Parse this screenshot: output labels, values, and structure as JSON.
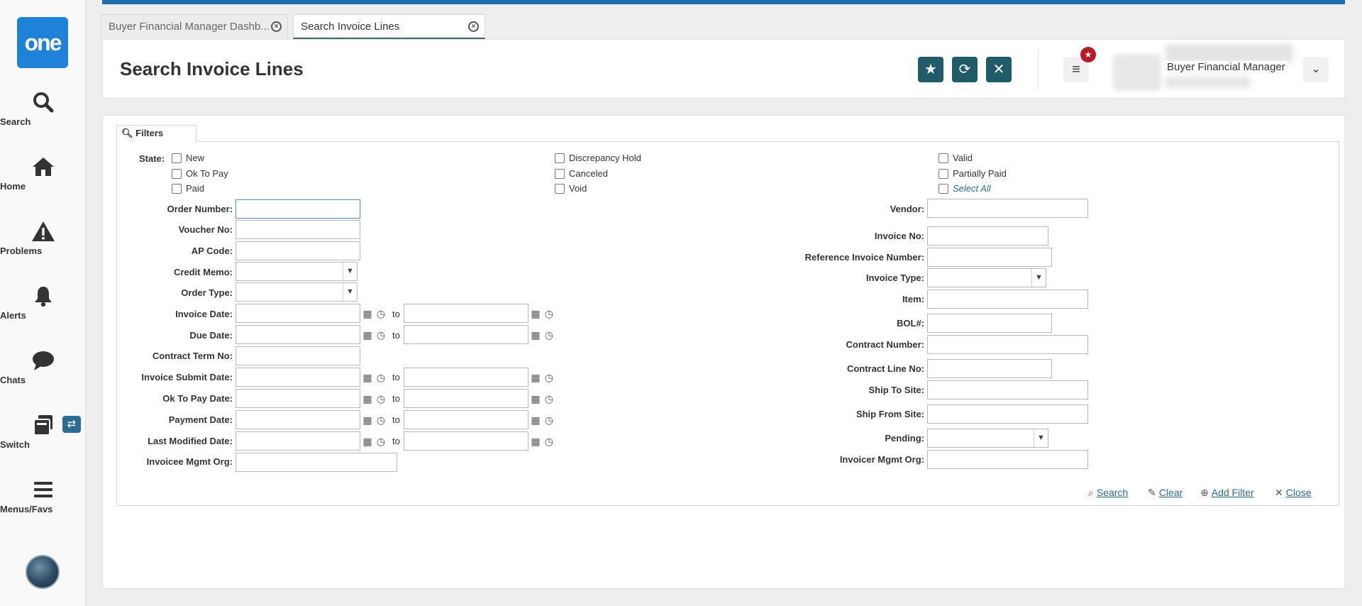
{
  "rail": {
    "logo": "one",
    "items": [
      {
        "label": "Search"
      },
      {
        "label": "Home"
      },
      {
        "label": "Problems"
      },
      {
        "label": "Alerts"
      },
      {
        "label": "Chats"
      },
      {
        "label": "Switch"
      },
      {
        "label": "Menus/Favs"
      }
    ]
  },
  "tabs": [
    {
      "label": "Buyer Financial Manager Dashb..."
    },
    {
      "label": "Search Invoice Lines"
    }
  ],
  "header": {
    "title": "Search Invoice Lines",
    "role": "Buyer Financial Manager"
  },
  "filters": {
    "tab_label": "Filters",
    "state_label": "State:",
    "states": [
      {
        "label": "New",
        "checked": false
      },
      {
        "label": "Ok To Pay",
        "checked": false
      },
      {
        "label": "Paid",
        "checked": false
      },
      {
        "label": "Discrepancy Hold",
        "checked": false
      },
      {
        "label": "Canceled",
        "checked": false
      },
      {
        "label": "Void",
        "checked": false
      },
      {
        "label": "Valid",
        "checked": false
      },
      {
        "label": "Partially Paid",
        "checked": false
      },
      {
        "label": "Select All",
        "checked": false
      }
    ],
    "left_fields": {
      "order_number": "Order Number:",
      "voucher_no": "Voucher No:",
      "ap_code": "AP Code:",
      "credit_memo": "Credit Memo:",
      "order_type": "Order Type:",
      "invoice_date": "Invoice Date:",
      "due_date": "Due Date:",
      "contract_term_no": "Contract Term No:",
      "invoice_submit_date": "Invoice Submit Date:",
      "ok_to_pay_date": "Ok To Pay Date:",
      "payment_date": "Payment Date:",
      "last_modified_date": "Last Modified Date:",
      "invoicee_mgmt_org": "Invoicee Mgmt Org:"
    },
    "right_fields": {
      "vendor": "Vendor:",
      "invoice_no": "Invoice No:",
      "reference_invoice_number": "Reference Invoice Number:",
      "invoice_type": "Invoice Type:",
      "item": "Item:",
      "bol": "BOL#:",
      "contract_number": "Contract Number:",
      "contract_line_no": "Contract Line No:",
      "ship_to_site": "Ship To Site:",
      "ship_from_site": "Ship From Site:",
      "pending": "Pending:",
      "invoicer_mgmt_org": "Invoicer Mgmt Org:"
    },
    "to_label": "to",
    "actions": {
      "search": "Search",
      "clear": "Clear",
      "add_filter": "Add Filter",
      "close": "Close"
    }
  },
  "colors": {
    "accent": "#1f5b69",
    "top_strip": "#1b6fae",
    "logo": "#1e83d8",
    "notification": "#b81a24",
    "link": "#2a6c93"
  }
}
